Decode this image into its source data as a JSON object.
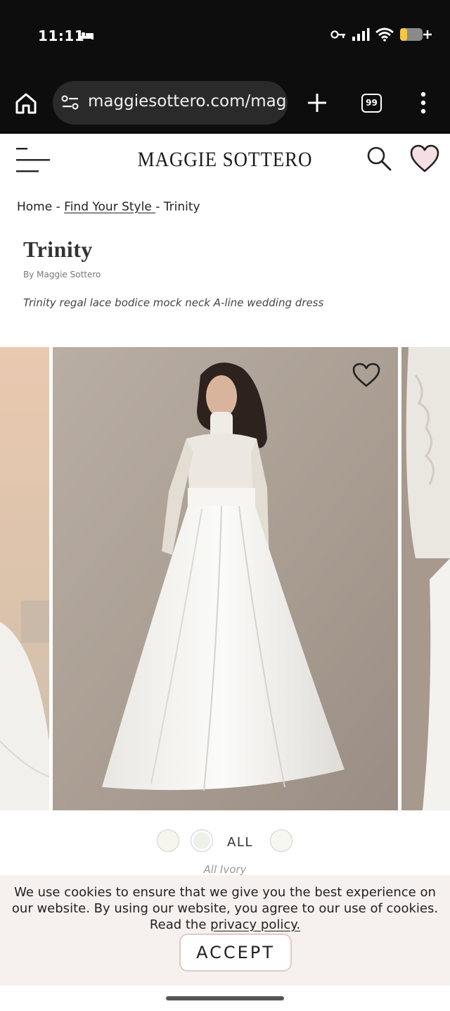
{
  "status_bar": {
    "time": "11:11"
  },
  "browser": {
    "url": "maggiesottero.com/mag",
    "tab_count": "99"
  },
  "site": {
    "brand": "MAGGIE SOTTERO"
  },
  "breadcrumb": {
    "home": "Home",
    "sep1": " - ",
    "find_style": "Find Your Style ",
    "sep2": "- ",
    "current": "Trinity"
  },
  "product": {
    "title": "Trinity",
    "by": "By Maggie Sottero",
    "description": "Trinity regal lace bodice mock neck A-line wedding dress"
  },
  "colors": {
    "all_label": "ALL",
    "selected_name": "All Ivory"
  },
  "cookie": {
    "text": "We use cookies to ensure that we give you the best experience on our website. By using our website, you agree to our use of cookies. Read the ",
    "link": "privacy policy.",
    "accept": "ACCEPT"
  },
  "icons": {
    "home": "home-icon",
    "site_settings": "tune-icon",
    "new_tab": "plus-icon",
    "tabs": "tabs-icon",
    "more": "more-vert-icon",
    "menu": "hamburger-icon",
    "search": "search-icon",
    "wishlist": "heart-icon"
  },
  "theme": {
    "accent_pink": "#e3c9c5",
    "heart_fill": "#f6dfe3",
    "battery_yellow": "#f5c842"
  }
}
